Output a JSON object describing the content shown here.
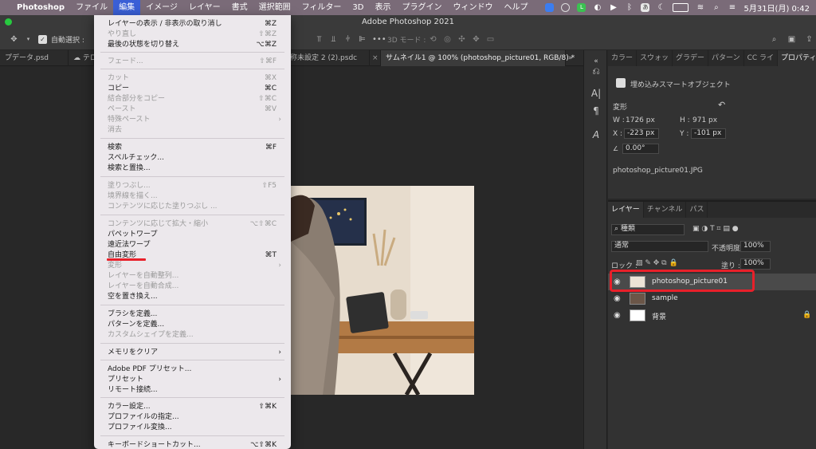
{
  "menubar": {
    "apple": "",
    "items": [
      "Photoshop",
      "ファイル",
      "編集",
      "イメージ",
      "レイヤー",
      "書式",
      "選択範囲",
      "フィルター",
      "3D",
      "表示",
      "プラグイン",
      "ウィンドウ",
      "ヘルプ"
    ],
    "clock": "5月31日(月)  0:42"
  },
  "window": {
    "title": "Adobe Photoshop 2021"
  },
  "options": {
    "auto_select": "自動選択 :",
    "mode_3d": "3D モード :"
  },
  "tabs": [
    {
      "label": "プデータ.psd"
    },
    {
      "label": "テロ"
    },
    {
      "label": "称未設定 2 (2).psdc"
    },
    {
      "label": "サムネイル1 @ 100% (photoshop_picture01, RGB/8) *"
    }
  ],
  "panel": {
    "tabs": [
      "カラー",
      "スウォッ",
      "グラデー",
      "パターン",
      "CC ライ",
      "プロパティ"
    ],
    "smart_object": "埋め込みスマートオブジェクト",
    "transform": "変形",
    "w_label": "W :",
    "w": "1726 px",
    "h_label": "H :",
    "h": "971 px",
    "x_label": "X :",
    "x": "-223 px",
    "y_label": "Y :",
    "y": "-101 px",
    "angle": "0.00°",
    "filename": "photoshop_picture01.JPG"
  },
  "layers_panel": {
    "tabs": [
      "レイヤー",
      "チャンネル",
      "パス"
    ],
    "kind": "種類",
    "blend": "通常",
    "opacity_label": "不透明度 :",
    "opacity": "100%",
    "lock_label": "ロック :",
    "fill_label": "塗り :",
    "fill": "100%",
    "layers": [
      {
        "name": "photoshop_picture01"
      },
      {
        "name": "sample"
      },
      {
        "name": "背景"
      }
    ]
  },
  "edit_menu": {
    "items": [
      {
        "label": "レイヤーの表示 / 非表示の取り消し",
        "key": "⌘Z",
        "disabled": false
      },
      {
        "label": "やり直し",
        "key": "⇧⌘Z",
        "disabled": true
      },
      {
        "label": "最後の状態を切り替え",
        "key": "⌥⌘Z",
        "disabled": false
      },
      {
        "label": "フェード...",
        "key": "⇧⌘F",
        "disabled": true
      },
      {
        "label": "カット",
        "key": "⌘X",
        "disabled": true
      },
      {
        "label": "コピー",
        "key": "⌘C",
        "disabled": false
      },
      {
        "label": "結合部分をコピー",
        "key": "⇧⌘C",
        "disabled": true
      },
      {
        "label": "ペースト",
        "key": "⌘V",
        "disabled": true
      },
      {
        "label": "特殊ペースト",
        "key": "",
        "disabled": true,
        "submenu": true
      },
      {
        "label": "消去",
        "key": "",
        "disabled": true
      },
      {
        "label": "検索",
        "key": "⌘F",
        "disabled": false
      },
      {
        "label": "スペルチェック...",
        "key": "",
        "disabled": false
      },
      {
        "label": "検索と置換...",
        "key": "",
        "disabled": false
      },
      {
        "label": "塗りつぶし...",
        "key": "⇧F5",
        "disabled": true
      },
      {
        "label": "境界線を描く...",
        "key": "",
        "disabled": true
      },
      {
        "label": "コンテンツに応じた塗りつぶし ...",
        "key": "",
        "disabled": true
      },
      {
        "label": "コンテンツに応じて拡大・縮小",
        "key": "⌥⇧⌘C",
        "disabled": true
      },
      {
        "label": "パペットワープ",
        "key": "",
        "disabled": false
      },
      {
        "label": "遠近法ワープ",
        "key": "",
        "disabled": false
      },
      {
        "label": "自由変形",
        "key": "⌘T",
        "disabled": false
      },
      {
        "label": "変形",
        "key": "",
        "disabled": true,
        "submenu": true
      },
      {
        "label": "レイヤーを自動整列...",
        "key": "",
        "disabled": true
      },
      {
        "label": "レイヤーを自動合成...",
        "key": "",
        "disabled": true
      },
      {
        "label": "空を置き換え...",
        "key": "",
        "disabled": false
      },
      {
        "label": "ブラシを定義...",
        "key": "",
        "disabled": false
      },
      {
        "label": "パターンを定義...",
        "key": "",
        "disabled": false
      },
      {
        "label": "カスタムシェイプを定義...",
        "key": "",
        "disabled": true
      },
      {
        "label": "メモリをクリア",
        "key": "",
        "disabled": false,
        "submenu": true
      },
      {
        "label": "Adobe PDF プリセット...",
        "key": "",
        "disabled": false
      },
      {
        "label": "プリセット",
        "key": "",
        "disabled": false,
        "submenu": true
      },
      {
        "label": "リモート接続...",
        "key": "",
        "disabled": false
      },
      {
        "label": "カラー設定...",
        "key": "⇧⌘K",
        "disabled": false
      },
      {
        "label": "プロファイルの指定...",
        "key": "",
        "disabled": false
      },
      {
        "label": "プロファイル変換...",
        "key": "",
        "disabled": false
      },
      {
        "label": "キーボードショートカット...",
        "key": "⌥⇧⌘K",
        "disabled": false
      }
    ]
  }
}
